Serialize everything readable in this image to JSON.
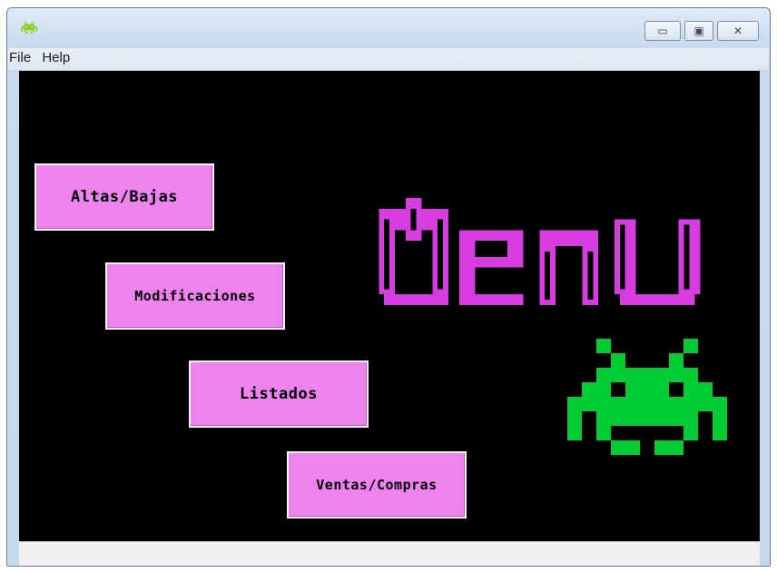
{
  "window": {
    "min_symbol": "▭",
    "max_symbol": "▣",
    "close_symbol": "✕"
  },
  "menubar": {
    "file": "File",
    "help": "Help"
  },
  "buttons": {
    "altas_bajas": "Altas/Bajas",
    "modificaciones": "Modificaciones",
    "listados": "Listados",
    "ventas_compras": "Ventas/Compras"
  },
  "logo_text": "Menu",
  "colors": {
    "logo": "#d63ce0",
    "invader": "#00cc33",
    "button": "#ee82ee",
    "background": "#000000"
  },
  "icons": [
    "invader-icon",
    "minimize-icon",
    "maximize-icon",
    "close-icon"
  ]
}
